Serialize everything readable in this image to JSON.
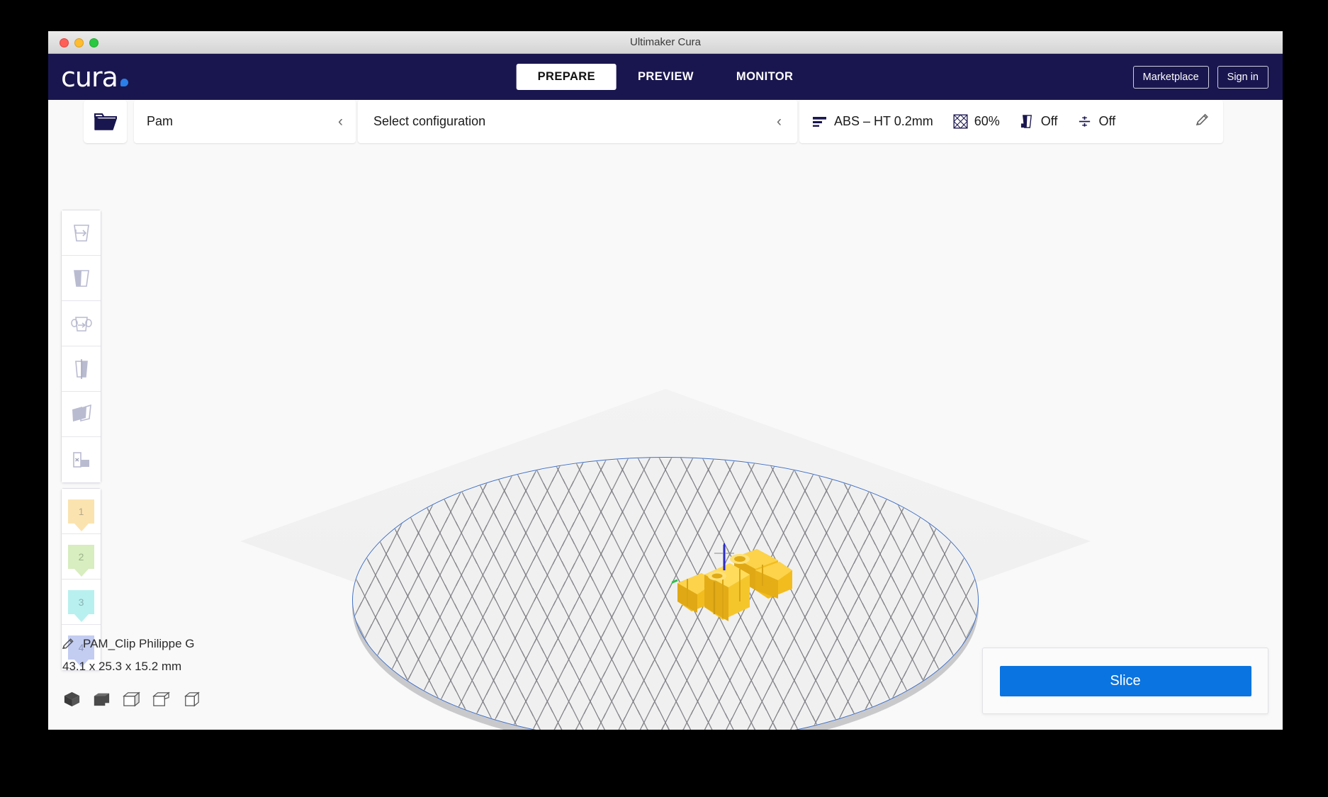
{
  "window": {
    "title": "Ultimaker Cura",
    "controls": {
      "close": "close",
      "minimize": "minimize",
      "maximize": "maximize"
    }
  },
  "header": {
    "logo_text": "cura",
    "tabs": [
      {
        "label": "PREPARE",
        "active": true
      },
      {
        "label": "PREVIEW",
        "active": false
      },
      {
        "label": "MONITOR",
        "active": false
      }
    ],
    "marketplace_label": "Marketplace",
    "signin_label": "Sign in"
  },
  "toolbar": {
    "open_file_icon": "open-folder-icon",
    "printer_name": "Pam",
    "printer_chevron": "‹",
    "configuration_label": "Select configuration",
    "configuration_chevron": "‹",
    "profile": {
      "icon": "layer-height-icon",
      "label": "ABS – HT 0.2mm"
    },
    "infill": {
      "icon": "infill-icon",
      "value": "60%"
    },
    "support": {
      "icon": "support-icon",
      "value": "Off"
    },
    "adhesion": {
      "icon": "adhesion-icon",
      "value": "Off"
    },
    "edit_icon": "pencil-icon"
  },
  "tools": {
    "items": [
      {
        "name": "move-tool",
        "icon": "move-icon"
      },
      {
        "name": "scale-tool",
        "icon": "scale-icon"
      },
      {
        "name": "rotate-tool",
        "icon": "rotate-icon"
      },
      {
        "name": "mirror-tool",
        "icon": "mirror-icon"
      },
      {
        "name": "per-model-settings-tool",
        "icon": "per-model-settings-icon"
      },
      {
        "name": "support-blocker-tool",
        "icon": "support-blocker-icon"
      }
    ]
  },
  "extruders": [
    {
      "number": "1",
      "color": "#fbe3b0"
    },
    {
      "number": "2",
      "color": "#d8edc0"
    },
    {
      "number": "3",
      "color": "#b8f0ef"
    },
    {
      "number": "4",
      "color": "#c3cdf2"
    }
  ],
  "object_info": {
    "edit_icon": "pencil-icon",
    "name": "PAM_Clip Philippe G",
    "dimensions": "43.1 x 25.3 x 15.2 mm",
    "view_modes": [
      {
        "name": "solid-view",
        "label": "solid"
      },
      {
        "name": "xray-view",
        "label": "x-ray"
      },
      {
        "name": "layer-view",
        "label": "layers"
      },
      {
        "name": "wireframe-view",
        "label": "wireframe"
      },
      {
        "name": "outline-view",
        "label": "outline"
      }
    ]
  },
  "slice_panel": {
    "slice_label": "Slice"
  },
  "scene": {
    "model_name": "PAM_Clip Philippe G",
    "model_color": "#f5c026",
    "build_plate_shape": "elliptic",
    "axis_z_color": "#2b2bc8",
    "axis_y_color": "#2fbf4f"
  },
  "colors": {
    "brand_dark": "#19164f",
    "accent_blue": "#0a74e0",
    "logo_dot": "#2a7fe8",
    "plate_edge": "#3f6fc4",
    "viewport_bg": "#f9f9f9"
  }
}
